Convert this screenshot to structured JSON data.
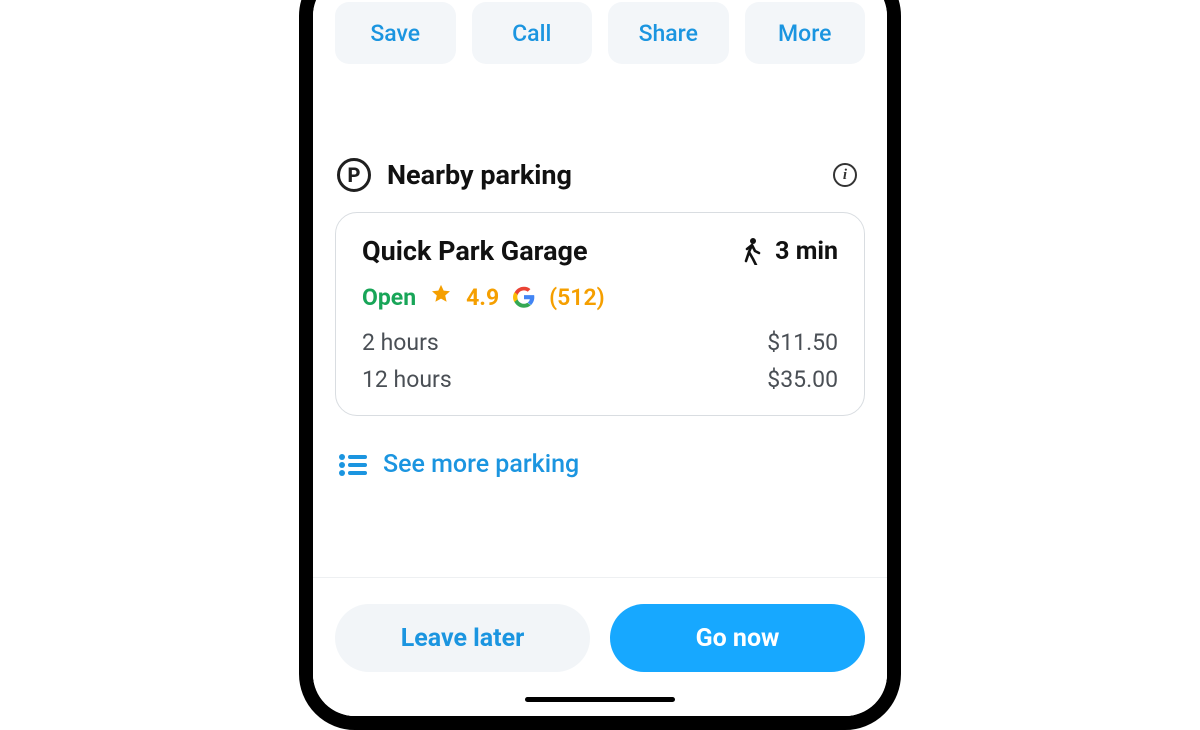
{
  "actions": {
    "save": "Save",
    "call": "Call",
    "share": "Share",
    "more": "More"
  },
  "section": {
    "title": "Nearby parking"
  },
  "parking_card": {
    "name": "Quick Park Garage",
    "walk_time": "3 min",
    "status": "Open",
    "rating": "4.9",
    "reviews": "(512)",
    "prices": [
      {
        "duration": "2 hours",
        "price": "$11.50"
      },
      {
        "duration": "12 hours",
        "price": "$35.00"
      }
    ]
  },
  "see_more": "See more parking",
  "bottom": {
    "leave_later": "Leave later",
    "go_now": "Go now"
  }
}
